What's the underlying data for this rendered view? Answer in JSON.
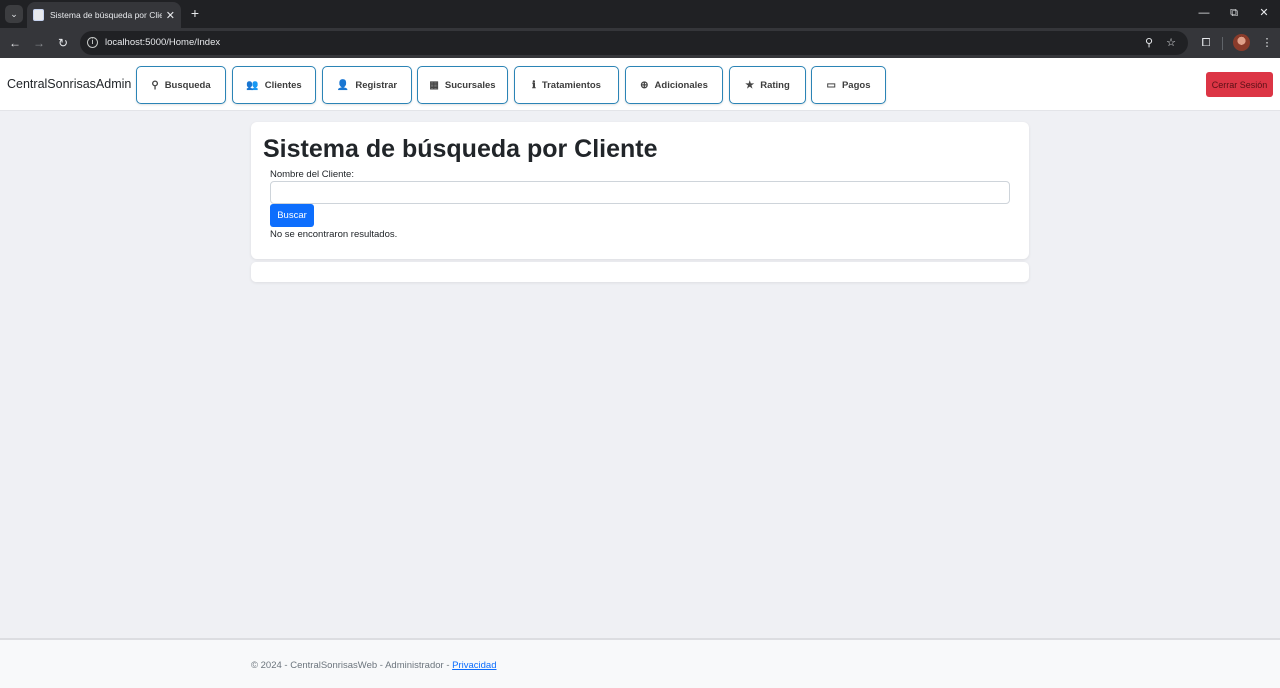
{
  "browser": {
    "tab_title": "Sistema de búsqueda por Clie",
    "url": "localhost:5000/Home/Index",
    "icons": {
      "tab_search": "⌄",
      "tab_close": "✕",
      "new_tab": "+",
      "minimize": "—",
      "restore": "⧉",
      "close": "✕",
      "back": "←",
      "forward": "→",
      "reload": "↻",
      "info": "i",
      "zoom": "⚲",
      "bookmark": "☆",
      "extensions": "⧠",
      "menu": "⋮"
    }
  },
  "navbar": {
    "brand": "CentralSonrisasAdmin",
    "items": [
      {
        "label": "Busqueda",
        "icon": "⚲",
        "icon_name": "search-icon"
      },
      {
        "label": "Clientes",
        "icon": "👥",
        "icon_name": "users-icon"
      },
      {
        "label": "Registrar",
        "icon": "👤",
        "icon_name": "user-plus-icon"
      },
      {
        "label": "Sucursales",
        "icon": "▦",
        "icon_name": "building-icon"
      },
      {
        "label": "Tratamientos",
        "icon": "ℹ",
        "icon_name": "info-circle-icon"
      },
      {
        "label": "Adicionales",
        "icon": "⊕",
        "icon_name": "plus-circle-icon"
      },
      {
        "label": "Rating",
        "icon": "★",
        "icon_name": "star-icon"
      },
      {
        "label": "Pagos",
        "icon": "▭",
        "icon_name": "money-bill-icon"
      }
    ],
    "logout_label": "Cerrar Sesión",
    "accent_color": "#2b84b6",
    "logout_color": "#dc3545"
  },
  "main": {
    "title": "Sistema de búsqueda por Cliente",
    "field_label": "Nombre del Cliente:",
    "input_value": "",
    "search_button": "Buscar",
    "results_message": "No se encontraron resultados.",
    "primary_color": "#0d6efd"
  },
  "footer": {
    "text": "© 2024 - CentralSonrisasWeb - Administrador - ",
    "link": "Privacidad"
  }
}
